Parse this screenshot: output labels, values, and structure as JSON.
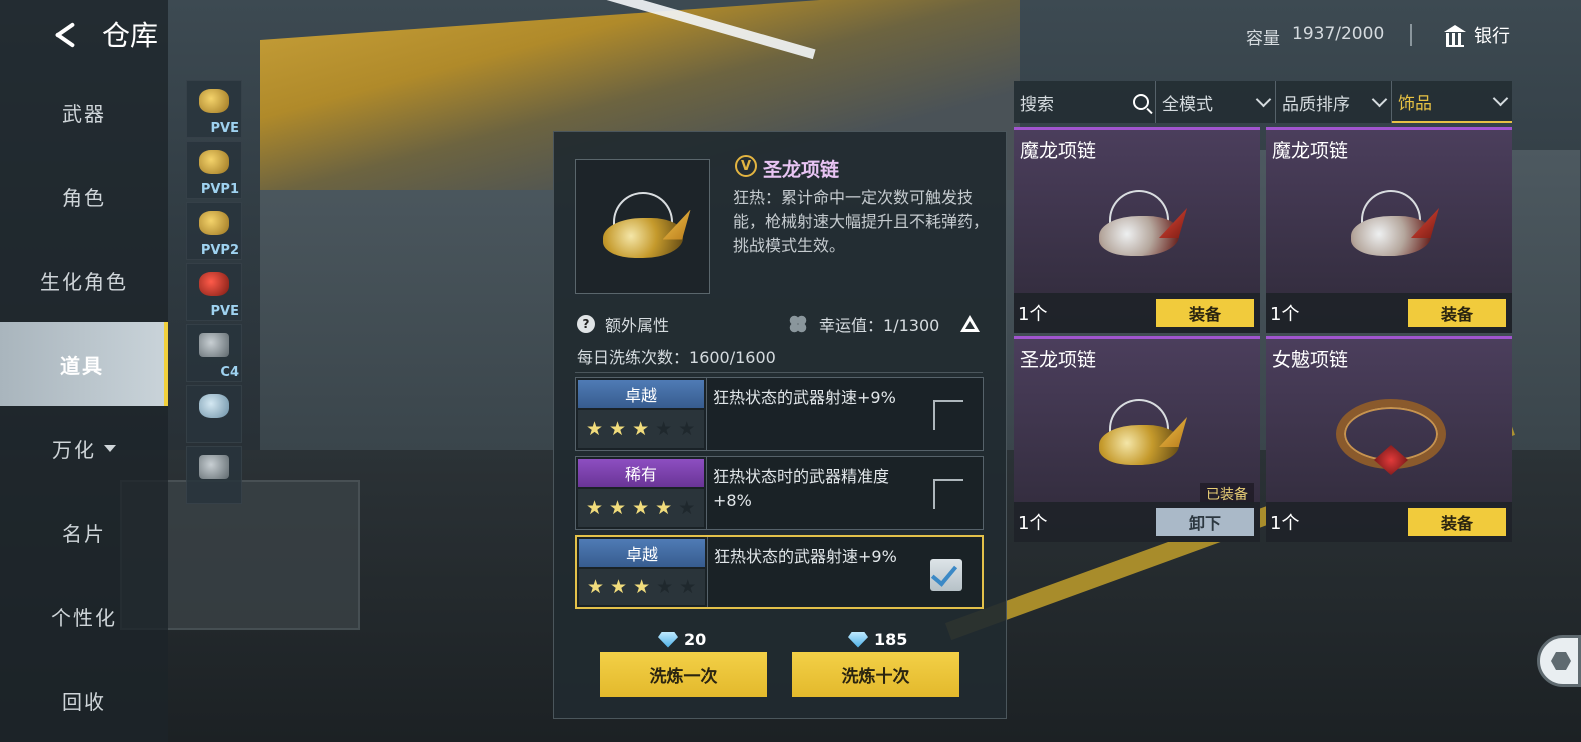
{
  "header": {
    "title": "仓库",
    "capacity_label": "容量",
    "capacity_value": "1937/2000",
    "bank_label": "银行"
  },
  "nav": {
    "items": [
      {
        "label": "武器"
      },
      {
        "label": "角色"
      },
      {
        "label": "生化角色"
      },
      {
        "label": "道具",
        "active": true
      },
      {
        "label": "万化"
      },
      {
        "label": "名片"
      },
      {
        "label": "个性化"
      },
      {
        "label": "回收"
      }
    ]
  },
  "thumbs": [
    {
      "tag": "PVE",
      "icon": "gun-icon"
    },
    {
      "tag": "PVP1",
      "icon": "dragon-necklace-icon"
    },
    {
      "tag": "PVP2",
      "icon": "necklace-icon"
    },
    {
      "tag": "PVE",
      "icon": "red-item-icon"
    },
    {
      "tag": "C4",
      "icon": "c4-icon"
    },
    {
      "tag": "",
      "icon": "helmet-icon"
    },
    {
      "tag": "",
      "icon": "robot-icon"
    }
  ],
  "detail": {
    "badge": "V",
    "name": "圣龙项链",
    "description": "狂热：累计命中一定次数可触发技能，枪械射速大幅提升且不耗弹药，挑战模式生效。",
    "extra_label": "额外属性",
    "luck_label": "幸运值：1/1300",
    "daily_label": "每日洗练次数：",
    "daily_value": "1600/1600",
    "attributes": [
      {
        "rarity": "卓越",
        "stars": 3,
        "text": "狂热状态的武器射速+9%",
        "checked": false
      },
      {
        "rarity": "稀有",
        "stars": 4,
        "text": "狂热状态时的武器精准度+8%",
        "checked": false
      },
      {
        "rarity": "卓越",
        "stars": 3,
        "text": "狂热状态的武器射速+9%",
        "checked": true
      }
    ],
    "cost_once": "20",
    "cost_ten": "185",
    "btn_once": "洗炼一次",
    "btn_ten": "洗炼十次"
  },
  "filters": {
    "search_placeholder": "搜索",
    "mode": "全模式",
    "sort": "品质排序",
    "category": "饰品"
  },
  "cards": [
    {
      "name": "魔龙项链",
      "count": "1个",
      "action": "装备",
      "equipped": ""
    },
    {
      "name": "魔龙项链",
      "count": "1个",
      "action": "装备",
      "equipped": ""
    },
    {
      "name": "圣龙项链",
      "count": "1个",
      "action": "卸下",
      "equipped": "已装备"
    },
    {
      "name": "女魃项链",
      "count": "1个",
      "action": "装备",
      "equipped": ""
    }
  ],
  "colors": {
    "accent_gold": "#f1cb3c",
    "purple": "#a155cf",
    "blue_rarity": "#4f7bb5"
  }
}
